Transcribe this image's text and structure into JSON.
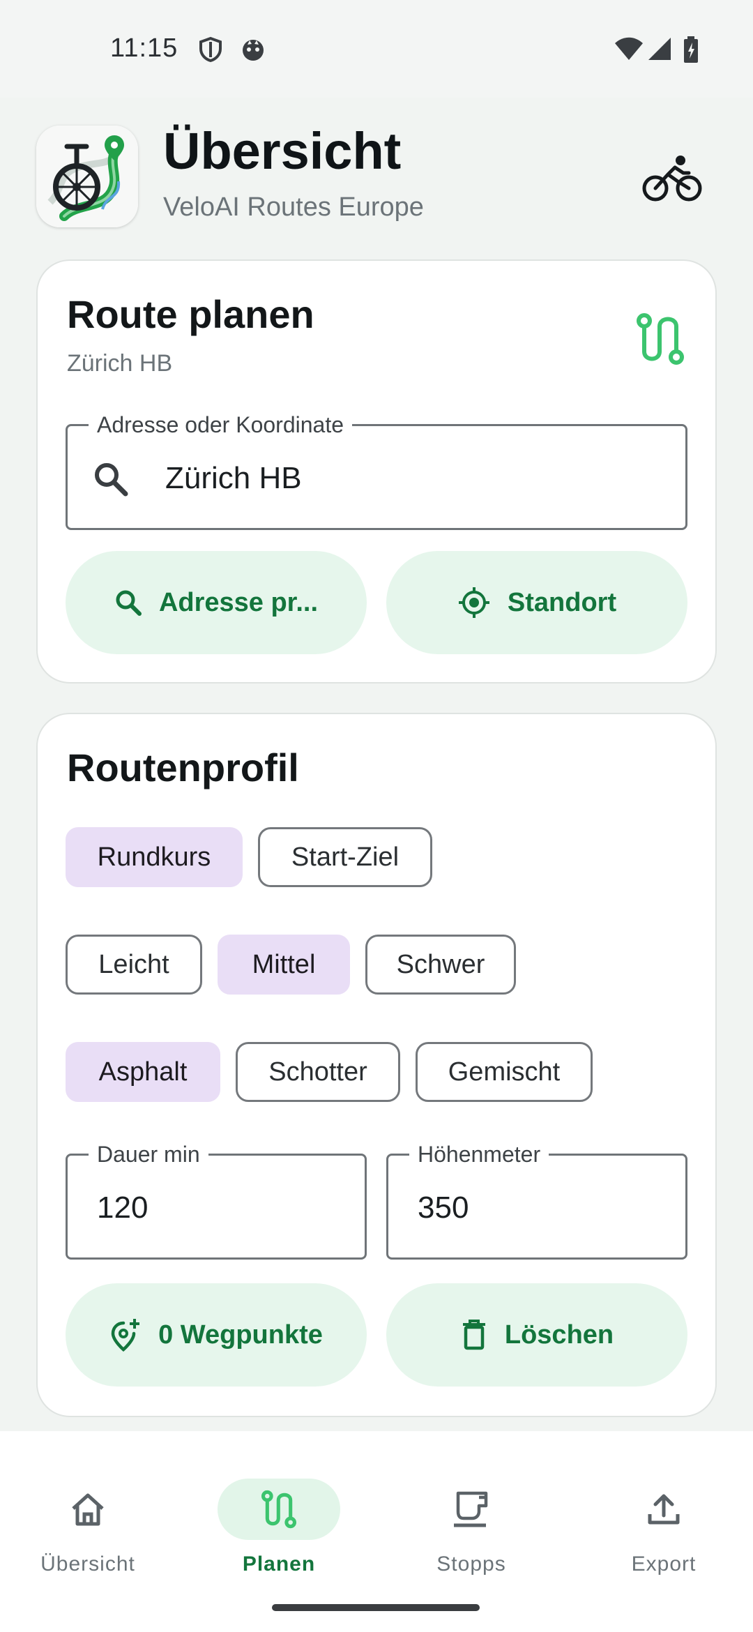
{
  "status_bar": {
    "time": "11:15",
    "left_icons": [
      "shield-icon",
      "cat-face-icon"
    ],
    "right_icons": [
      "wifi-icon",
      "signal-icon",
      "battery-charging-icon"
    ]
  },
  "header": {
    "title": "Übersicht",
    "subtitle": "VeloAI Routes Europe",
    "logo_icon": "unicycle-route-logo-icon",
    "action_icon": "bicycle-icon"
  },
  "route_card": {
    "title": "Route planen",
    "subtitle": "Zürich HB",
    "icon": "route-icon",
    "address_field": {
      "label": "Adresse oder Koordinate",
      "value": "Zürich HB",
      "icon": "search-icon"
    },
    "buttons": {
      "check_address": "Adresse pr...",
      "location": "Standort"
    }
  },
  "profile_card": {
    "title": "Routenprofil",
    "route_type": {
      "options": [
        "Rundkurs",
        "Start-Ziel"
      ],
      "selected": "Rundkurs"
    },
    "difficulty": {
      "options": [
        "Leicht",
        "Mittel",
        "Schwer"
      ],
      "selected": "Mittel"
    },
    "surface": {
      "options": [
        "Asphalt",
        "Schotter",
        "Gemischt"
      ],
      "selected": "Asphalt"
    },
    "duration": {
      "label": "Dauer min",
      "value": "120"
    },
    "elevation": {
      "label": "Höhenmeter",
      "value": "350"
    },
    "buttons": {
      "waypoints": "0 Wegpunkte",
      "delete": "Löschen"
    }
  },
  "bottom_nav": {
    "items": [
      {
        "label": "Übersicht",
        "icon": "home-icon",
        "active": false
      },
      {
        "label": "Planen",
        "icon": "route-icon",
        "active": true
      },
      {
        "label": "Stopps",
        "icon": "coffee-cup-icon",
        "active": false
      },
      {
        "label": "Export",
        "icon": "upload-icon",
        "active": false
      }
    ]
  },
  "colors": {
    "accent_green": "#13753c",
    "route_green": "#3cc46e",
    "tonal_green": "#e6f6ec",
    "chip_selected": "#e9def6"
  }
}
